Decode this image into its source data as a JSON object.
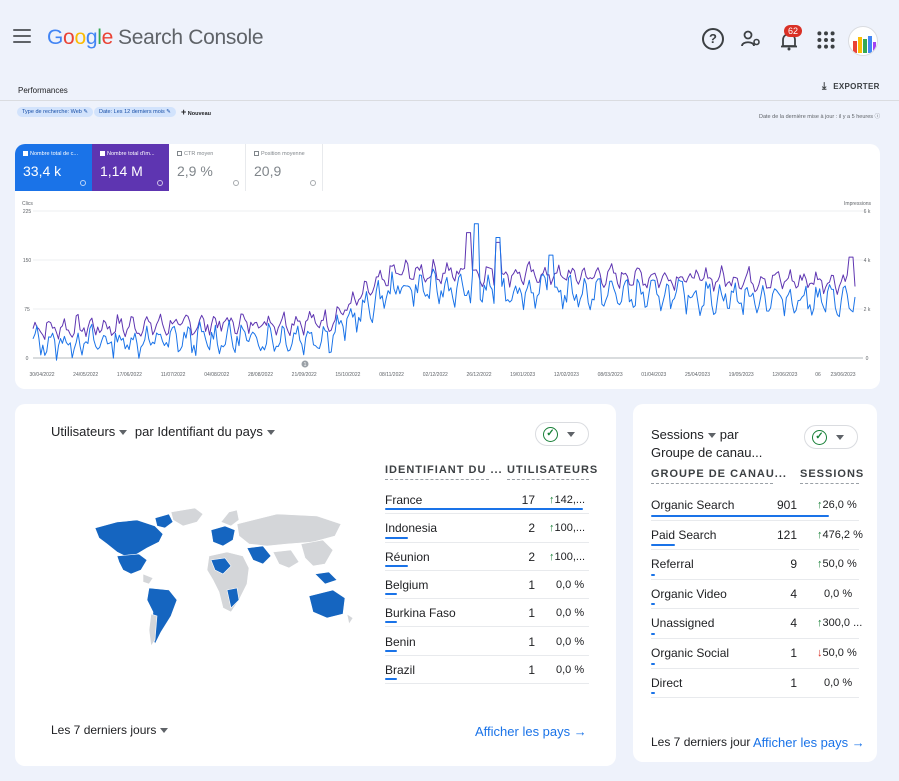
{
  "header": {
    "logo_google": [
      "G",
      "o",
      "o",
      "g",
      "l",
      "e"
    ],
    "logo_colors": [
      "#4285f4",
      "#ea4335",
      "#fbbc05",
      "#4285f4",
      "#34a853",
      "#ea4335"
    ],
    "product": "Search Console",
    "notifications_count": "62",
    "help_glyph": "?"
  },
  "subbar": {
    "title": "Performances",
    "export_label": "EXPORTER",
    "chips": [
      "Type de recherche: Web",
      "Date: Les 12 derniers mois"
    ],
    "new_label": "Nouveau",
    "last_update": "Date de la dernière mise à jour : il y a 5 heures"
  },
  "metrics": [
    {
      "label": "Nombre total de c...",
      "value": "33,4 k",
      "active": true
    },
    {
      "label": "Nombre total d'im...",
      "value": "1,14 M",
      "active": true
    },
    {
      "label": "CTR moyen",
      "value": "2,9 %",
      "active": false
    },
    {
      "label": "Position moyenne",
      "value": "20,9",
      "active": false
    }
  ],
  "chart_data": {
    "type": "line",
    "left_axis_label": "Clics",
    "right_axis_label": "Impressions",
    "left_ticks": [
      "225",
      "150",
      "75",
      "0"
    ],
    "right_ticks": [
      "6 k",
      "4 k",
      "2 k",
      "0"
    ],
    "x_labels": [
      "30/04/2022",
      "24/05/2022",
      "17/06/2022",
      "11/07/2022",
      "04/08/2022",
      "28/08/2022",
      "21/09/2022",
      "15/10/2022",
      "08/11/2022",
      "02/12/2022",
      "26/12/2022",
      "19/01/2023",
      "12/02/2023",
      "08/03/2023",
      "01/04/2023",
      "25/04/2023",
      "19/05/2023",
      "12/06/2023",
      "06",
      "23/06/2023"
    ],
    "series": [
      {
        "name": "Clics",
        "color": "#1a73e8"
      },
      {
        "name": "Impressions",
        "color": "#5e35b1"
      }
    ],
    "annotation_marker": "1"
  },
  "users_card": {
    "metric_label": "Utilisateurs",
    "dimension_label": "par Identifiant du pays",
    "col_dimension": "IDENTIFIANT DU ...",
    "col_metric": "UTILISATEURS",
    "rows": [
      {
        "name": "France",
        "value": "17",
        "change": "142,...",
        "dir": "up",
        "bar": 1.0
      },
      {
        "name": "Indonesia",
        "value": "2",
        "change": "100,...",
        "dir": "up",
        "bar": 0.118
      },
      {
        "name": "Réunion",
        "value": "2",
        "change": "100,...",
        "dir": "up",
        "bar": 0.118
      },
      {
        "name": "Belgium",
        "value": "1",
        "change": "0,0 %",
        "dir": "none",
        "bar": 0.059
      },
      {
        "name": "Burkina Faso",
        "value": "1",
        "change": "0,0 %",
        "dir": "none",
        "bar": 0.059
      },
      {
        "name": "Benin",
        "value": "1",
        "change": "0,0 %",
        "dir": "none",
        "bar": 0.059
      },
      {
        "name": "Brazil",
        "value": "1",
        "change": "0,0 %",
        "dir": "none",
        "bar": 0.059
      }
    ],
    "period_label": "Les 7 derniers jours",
    "link_label": "Afficher les pays"
  },
  "sessions_card": {
    "metric_label": "Sessions",
    "dimension_line1": "par",
    "dimension_line2": "Groupe de canau...",
    "col_dimension": "GROUPE DE CANAU...",
    "col_metric": "SESSIONS",
    "rows": [
      {
        "name": "Organic Search",
        "value": "901",
        "change": "26,0 %",
        "dir": "up",
        "bar": 1.0
      },
      {
        "name": "Paid Search",
        "value": "121",
        "change": "476,2 %",
        "dir": "up",
        "bar": 0.134
      },
      {
        "name": "Referral",
        "value": "9",
        "change": "50,0 %",
        "dir": "up",
        "bar": 0.02
      },
      {
        "name": "Organic Video",
        "value": "4",
        "change": "0,0 %",
        "dir": "none",
        "bar": 0.01
      },
      {
        "name": "Unassigned",
        "value": "4",
        "change": "300,0 ...",
        "dir": "up",
        "bar": 0.01
      },
      {
        "name": "Organic Social",
        "value": "1",
        "change": "50,0 %",
        "dir": "down",
        "bar": 0.005
      },
      {
        "name": "Direct",
        "value": "1",
        "change": "0,0 %",
        "dir": "none",
        "bar": 0.005
      }
    ],
    "period_label": "Les 7 derniers jour",
    "link_label": "Afficher les pays"
  }
}
